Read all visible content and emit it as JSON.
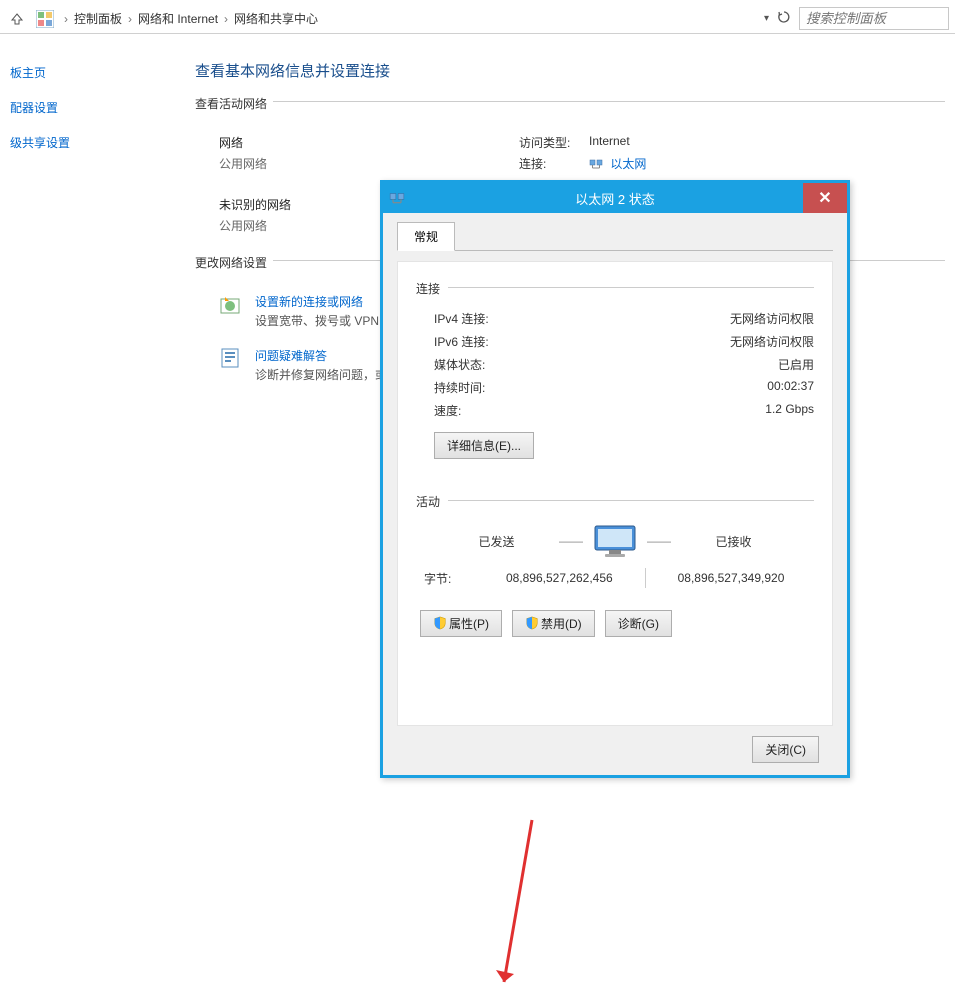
{
  "nav": {
    "crumb1": "控制面板",
    "crumb2": "网络和 Internet",
    "crumb3": "网络和共享中心",
    "sep": "›",
    "search_placeholder": "搜索控制面板"
  },
  "sidebar": {
    "home": "板主页",
    "adapter": "配器设置",
    "sharing": "级共享设置"
  },
  "main": {
    "title": "查看基本网络信息并设置连接",
    "active_label": "查看活动网络",
    "net1_title": "网络",
    "net1_sub": "公用网络",
    "access_label": "访问类型:",
    "access_value": "Internet",
    "conn_label": "连接:",
    "conn_value": "以太网",
    "net2_title": "未识别的网络",
    "net2_sub": "公用网络",
    "change_label": "更改网络设置",
    "item1_link": "设置新的连接或网络",
    "item1_desc": "设置宽带、拨号或 VPN 连",
    "item2_link": "问题疑难解答",
    "item2_desc": "诊断并修复网络问题，或者"
  },
  "dialog": {
    "title": "以太网 2 状态",
    "tab": "常规",
    "sect_conn": "连接",
    "ipv4_k": "IPv4 连接:",
    "ipv4_v": "无网络访问权限",
    "ipv6_k": "IPv6 连接:",
    "ipv6_v": "无网络访问权限",
    "media_k": "媒体状态:",
    "media_v": "已启用",
    "dur_k": "持续时间:",
    "dur_v": "00:02:37",
    "speed_k": "速度:",
    "speed_v": "1.2 Gbps",
    "details_btn": "详细信息(E)...",
    "sect_act": "活动",
    "sent": "已发送",
    "recv": "已接收",
    "bytes_label": "字节:",
    "bytes_sent": "08,896,527,262,456",
    "bytes_recv": "08,896,527,349,920",
    "prop_btn": "属性(P)",
    "disable_btn": "禁用(D)",
    "diag_btn": "诊断(G)",
    "close_btn": "关闭(C)"
  }
}
